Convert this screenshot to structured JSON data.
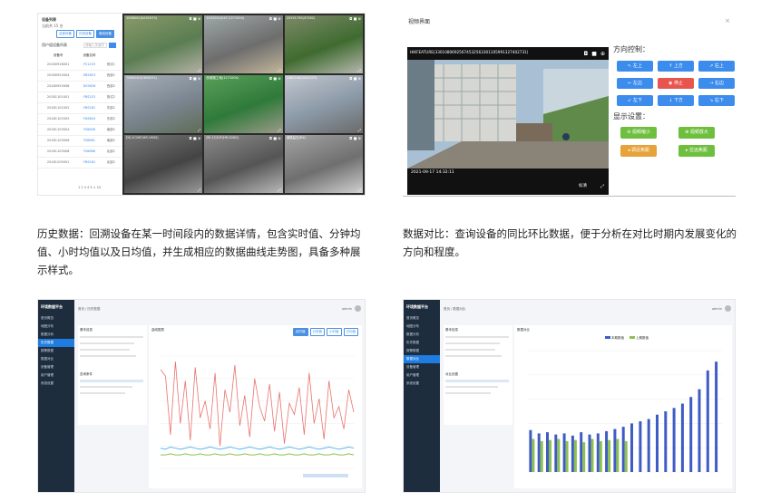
{
  "panel1": {
    "side_title": "设备列表",
    "side_sub": "当前共 15 台",
    "side_tabs": [
      "全部设备",
      "在线设备",
      "离线设备"
    ],
    "side_list_title": "用户组设备列表",
    "side_search": "请输入关键字",
    "table_headers": [
      "设备号",
      "设备名称",
      ""
    ],
    "rows": [
      [
        "20180918001",
        "FS1203",
        "测试1"
      ],
      [
        "20180920004",
        "ZB5623",
        "西部1"
      ],
      [
        "20180920006",
        "DS5626",
        "西部2"
      ],
      [
        "20181101001",
        "FBS203",
        "测试2"
      ],
      [
        "20181101002",
        "FBS262",
        "东部1"
      ],
      [
        "20181102003",
        "FD6604",
        "东部2"
      ],
      [
        "20181103004",
        "FS6806",
        "南部1"
      ],
      [
        "20181103006",
        "FS6861",
        "南部2"
      ],
      [
        "20181103008",
        "FS6868",
        "北部1"
      ],
      [
        "20181205001",
        "FBS262",
        "北部2"
      ]
    ],
    "pager": "1 2 3 4 5 > 10",
    "cells": [
      "1008002(0A92033)",
      "2041001(047-2271004)",
      "20191730(07282)",
      "7060240(2460031)",
      "西城路工地(1271004)",
      "1080244(0401025)",
      "DS-1C20F(HR-19DS)",
      "DS-1C20F(HR-20DS)",
      "道路监控(RK)"
    ]
  },
  "panel2": {
    "dialog_title": "视频界面",
    "close": "×",
    "video_label": "HIKFEATURE(33010806925674532563301105991327402731)",
    "timestamp": "2021-09-17 14:32:11",
    "dir_title": "方向控制：",
    "dir_buttons": [
      "↖ 左上",
      "↑ 上方",
      "↗ 右上",
      "← 左边",
      "◉ 停止",
      "→ 右边",
      "↙ 左下",
      "↓ 下方",
      "↘ 右下"
    ],
    "disp_title": "显示设置：",
    "disp_buttons": [
      "⊖ 视频缩小",
      "⊕ 视频放大",
      "◂ 调近焦距",
      "▸ 拉远焦距"
    ],
    "video_footer": "标清"
  },
  "captions": {
    "left": "历史数据：回溯设备在某一时间段内的数据详情，包含实时值、分钟均值、小时均值以及日均值，并生成相应的数据曲线走势图，具备多种展示样式。",
    "right": "数据对比：查询设备的同比环比数据，便于分析在对比时期内发展变化的方向和程度。"
  },
  "panel3": {
    "app_title": "环境数据平台",
    "menu": [
      "首页概览",
      "地图分布",
      "数据分析",
      "历史数据",
      "报警数据",
      "数据对比",
      "设备管理",
      "用户管理",
      "系统设置"
    ],
    "breadcrumb": "首页 / 历史数据",
    "info_title": "基本信息",
    "query_title": "查询条件",
    "chart_title": "曲线图表",
    "tabs": [
      "实时值",
      "分钟值",
      "小时值",
      "日均值"
    ],
    "user": "admin"
  },
  "panel4": {
    "app_title": "环境数据平台",
    "menu": [
      "首页概览",
      "地图分布",
      "数据分析",
      "历史数据",
      "报警数据",
      "数据对比",
      "设备管理",
      "用户管理",
      "系统设置"
    ],
    "breadcrumb": "首页 / 数据对比",
    "info_title": "基本信息",
    "query_title": "对比设置",
    "chart_title": "数据对比",
    "legend": [
      "本期数值",
      "上期数值"
    ],
    "user": "admin"
  },
  "chart_data": [
    {
      "type": "line",
      "series": [
        {
          "values": [
            88,
            82,
            30,
            95,
            40,
            78,
            25,
            90,
            45,
            60,
            35,
            85,
            20,
            70,
            50,
            92,
            38,
            65,
            28,
            80,
            55,
            42,
            75,
            33,
            68,
            22,
            58,
            48,
            72,
            30,
            85,
            40,
            62,
            26,
            78,
            45,
            55,
            35,
            70,
            50
          ]
        },
        {
          "values": [
            18,
            17,
            19,
            18,
            17,
            18,
            19,
            18,
            17,
            18,
            19,
            18,
            17,
            18,
            19,
            18,
            17,
            18,
            19,
            18,
            17,
            18,
            19,
            18,
            17,
            18,
            19,
            18,
            17,
            18,
            19,
            18,
            17,
            18,
            19,
            18,
            17,
            18,
            19,
            18
          ]
        },
        {
          "values": [
            12,
            12,
            13,
            12,
            12,
            13,
            12,
            12,
            13,
            12,
            12,
            13,
            12,
            12,
            13,
            12,
            12,
            13,
            12,
            12,
            13,
            12,
            12,
            13,
            12,
            12,
            13,
            12,
            12,
            13,
            12,
            12,
            13,
            12,
            12,
            13,
            12,
            12,
            13,
            12
          ]
        }
      ],
      "ylim": [
        0,
        100
      ]
    },
    {
      "type": "bar",
      "series": [
        {
          "values": [
            38,
            35,
            36,
            34,
            35,
            33,
            36,
            34,
            35,
            37,
            39,
            41,
            44,
            46,
            48,
            52,
            55,
            58,
            62,
            68,
            75,
            92,
            100
          ]
        },
        {
          "values": [
            30,
            28,
            29,
            30,
            28,
            29,
            27,
            30,
            28,
            29,
            30,
            28,
            0,
            0,
            0,
            0,
            0,
            0,
            0,
            0,
            0,
            0,
            0
          ]
        }
      ],
      "ylim": [
        0,
        110
      ],
      "colors": [
        "#3f5bc4",
        "#8cc152"
      ]
    }
  ]
}
